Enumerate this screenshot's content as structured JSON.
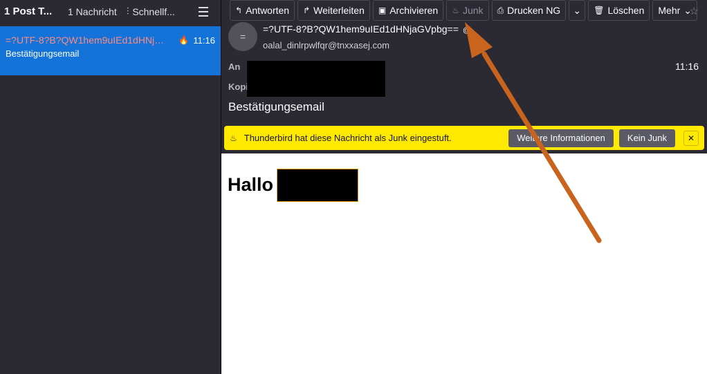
{
  "left": {
    "folder_title": "1 Post T...",
    "message_count": "1 Nachricht",
    "quickfilter_label": "Schnellf...",
    "message": {
      "subject": "=?UTF-8?B?QW1hem9uIEd1dHNjaGVpbg...",
      "time": "11:16",
      "preview": "Bestätigungsemail"
    }
  },
  "toolbar": {
    "reply": "Antworten",
    "forward": "Weiterleiten",
    "archive": "Archivieren",
    "junk": "Junk",
    "print": "Drucken NG",
    "delete": "Löschen",
    "more": "Mehr"
  },
  "header": {
    "avatar_initial": "=",
    "from_name": "=?UTF-8?B?QW1hem9uIEd1dHNjaGVpbg==",
    "from_address": "oalal_dinlrpwlfqr@tnxxasej.com",
    "to_label": "An",
    "cc_label": "Kopi",
    "time": "11:16",
    "subject": "Bestätigungsemail"
  },
  "junkbar": {
    "message": "Thunderbird hat diese Nachricht als Junk eingestuft.",
    "info_button": "Weitere Informationen",
    "not_junk_button": "Kein Junk",
    "close": "✕"
  },
  "body": {
    "greeting": "Hallo"
  },
  "colors": {
    "selected_row": "#1373d9",
    "junk_bar": "#ffe900",
    "annotation_arrow": "#c8641e"
  },
  "icons": [
    "reply-icon",
    "forward-icon",
    "archive-icon",
    "junk-icon",
    "print-icon",
    "trash-icon",
    "star-icon",
    "flame-icon",
    "close-icon"
  ]
}
